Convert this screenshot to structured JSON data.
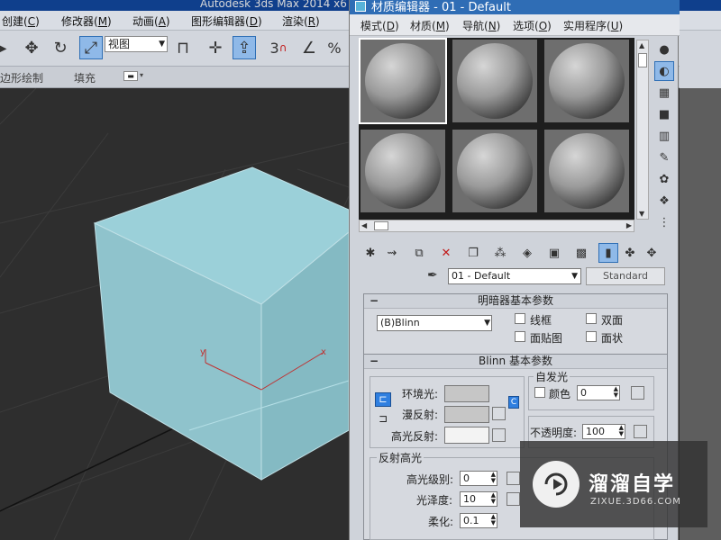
{
  "app": {
    "title": "Autodesk 3ds Max  2014 x6"
  },
  "menubar": {
    "items": [
      {
        "label": "创建(",
        "key": "C",
        "end": ")"
      },
      {
        "label": "修改器(",
        "key": "M",
        "end": ")"
      },
      {
        "label": "动画(",
        "key": "A",
        "end": ")"
      },
      {
        "label": "图形编辑器(",
        "key": "D",
        "end": ")"
      },
      {
        "label": "渲染(",
        "key": "R",
        "end": ")"
      }
    ]
  },
  "toolbar": {
    "view_select": "视图",
    "snap_label": "3",
    "percent_label": "%"
  },
  "ribbon": {
    "items": [
      "多边形绘制",
      "填充"
    ]
  },
  "viewport": {
    "box_color": "#8fc3cc",
    "axis_x": "x",
    "axis_y": "y"
  },
  "material_editor": {
    "title": "材质编辑器 - 01 - Default",
    "menu": [
      {
        "label": "模式(",
        "key": "D",
        "end": ")"
      },
      {
        "label": "材质(",
        "key": "M",
        "end": ")"
      },
      {
        "label": "导航(",
        "key": "N",
        "end": ")"
      },
      {
        "label": "选项(",
        "key": "O",
        "end": ")"
      },
      {
        "label": "实用程序(",
        "key": "U",
        "end": ")"
      }
    ],
    "slots": [
      {
        "active": true
      },
      {
        "active": false
      },
      {
        "active": false
      },
      {
        "active": false
      },
      {
        "active": false
      },
      {
        "active": false
      }
    ],
    "material_name": "01 - Default",
    "material_type": "Standard",
    "shader_rollout": {
      "title": "明暗器基本参数",
      "shader": "(B)Blinn",
      "options": [
        "线框",
        "双面",
        "面贴图",
        "面状"
      ]
    },
    "blinn_rollout": {
      "title": "Blinn 基本参数",
      "ambient_label": "环境光:",
      "diffuse_label": "漫反射:",
      "specular_label": "高光反射:",
      "self_illum_group": "自发光",
      "color_label": "颜色",
      "color_value": "0",
      "opacity_label": "不透明度:",
      "opacity_value": "100",
      "lock_letter": "C",
      "ambient_color": "#c6c6c6",
      "diffuse_color": "#c6c6c6",
      "specular_color": "#f3f3f3",
      "spec_group": "反射高光",
      "spec_level_label": "高光级别:",
      "spec_level_value": "0",
      "gloss_label": "光泽度:",
      "gloss_value": "10",
      "soften_label": "柔化:",
      "soften_value": "0.1"
    }
  },
  "watermark": {
    "title": "溜溜自学",
    "subtitle": "ZIXUE.3D66.COM"
  }
}
